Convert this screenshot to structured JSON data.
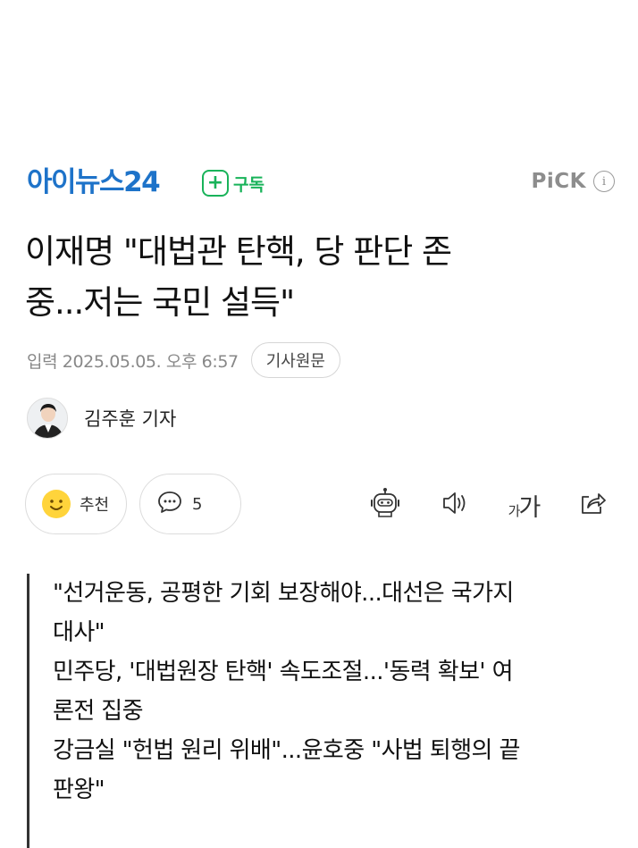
{
  "masthead": {
    "logo_text": "아이뉴스24",
    "subscribe_plus": "+",
    "subscribe_label": "구독",
    "pick_label": "PiCK",
    "info_glyph": "i",
    "brand_color": "#1e73c9",
    "subscribe_color": "#19b35a"
  },
  "article": {
    "headline_line1": "이재명 \"대법관 탄핵, 당 판단 존",
    "headline_line2": "중...저는 국민 설득\"",
    "date": "입력 2025.05.05. 오후 6:57",
    "original_button": "기사원문",
    "author": "김주훈 기자"
  },
  "actions": {
    "recommend_label": "추천",
    "comment_count": "5",
    "font_small": "가",
    "font_large": "가"
  },
  "icons": {
    "recommend": "smile-icon",
    "comment": "speech-bubble-icon",
    "summary": "robot-icon",
    "tts": "speaker-icon",
    "font": "font-size-icon",
    "share": "share-icon"
  },
  "summary": {
    "lines": [
      "\"선거운동, 공평한 기회 보장해야...대선은 국가지",
      "대사\"",
      "민주당, '대법원장 탄핵' 속도조절...'동력 확보' 여",
      "론전 집중",
      "강금실 \"헌법 원리 위배\"...윤호중 \"사법 퇴행의 끝",
      "판왕\""
    ]
  }
}
